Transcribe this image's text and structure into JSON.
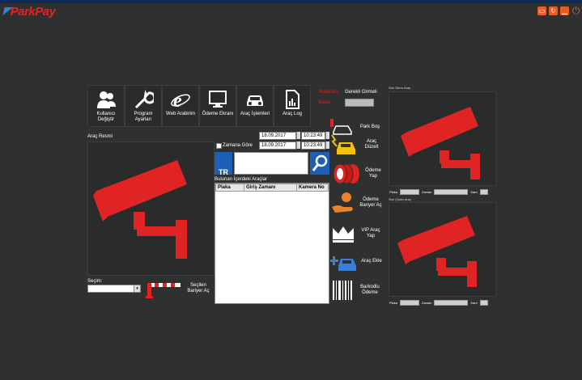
{
  "app": {
    "logo_text": "ParkPay"
  },
  "window_icons": [
    "monitor-icon",
    "refresh-icon",
    "minimize-icon",
    "power-icon"
  ],
  "toolbar": [
    {
      "name": "kullanici-degistir-button",
      "icon": "users-icon",
      "label": "Kullanıcı Değiştir"
    },
    {
      "name": "program-ayarlari-button",
      "icon": "wrench-icon",
      "label": "Program Ayarları"
    },
    {
      "name": "web-arabirim-button",
      "icon": "browser-icon",
      "label": "Web Arabirim"
    },
    {
      "name": "odeme-ekrani-button",
      "icon": "monitor-icon",
      "label": "Ödeme Ekranı"
    },
    {
      "name": "arac-islemleri-button",
      "icon": "car-icon",
      "label": "Araç İşlemleri"
    },
    {
      "name": "arac-log-button",
      "icon": "document-icon",
      "label": "Araç Log"
    }
  ],
  "status": {
    "label_red_1": "Kullanıcı:",
    "value_1": "Gerekli Girmeli",
    "label_red_2": "Kasa:"
  },
  "main": {
    "arac_resmi_label": "Araç Resmi",
    "secim_label": "Seçim:",
    "secilen_bariyer_ac": "Seçilen Bariyer Aç",
    "date_from": "18.09.2017",
    "time_from": "10:23:49",
    "date_to": "18.09.2017",
    "time_to": "10:23:49",
    "zamana_gore": "Zamana Göre",
    "lang": "TR",
    "list_title": "Bulunan İçerdeki Araçlar",
    "columns": [
      "Plaka",
      "Giriş Zamanı",
      "Kamera No"
    ]
  },
  "side_buttons": [
    {
      "name": "park-bos-button",
      "icon": "car-outline-icon",
      "label": "Park Boş"
    },
    {
      "name": "arac-duzelt-button",
      "icon": "car-yellow-icon",
      "label": "Araç Düzelt"
    },
    {
      "name": "odeme-yap-button",
      "icon": "coins-icon",
      "label": "Ödeme Yap"
    },
    {
      "name": "odeme-bariyer-ac-button",
      "icon": "hand-coin-icon",
      "label": "Ödeme Bariyer Aç"
    },
    {
      "name": "vip-arac-yap-button",
      "icon": "crown-icon",
      "label": "VIP Araç Yap"
    },
    {
      "name": "arac-ekle-button",
      "icon": "car-add-icon",
      "label": "Araç Ekle"
    },
    {
      "name": "barkodlu-odeme-button",
      "icon": "barcode-icon",
      "label": "Barkodlu Ödeme"
    }
  ],
  "cameras": {
    "entry_label": "Son Giren Araç",
    "exit_label": "Son Çıkan Araç",
    "plaka": "Plaka",
    "zaman": "Zaman",
    "kam": "Kam"
  },
  "colors": {
    "accent_red": "#e02424",
    "background": "#2f3131"
  }
}
